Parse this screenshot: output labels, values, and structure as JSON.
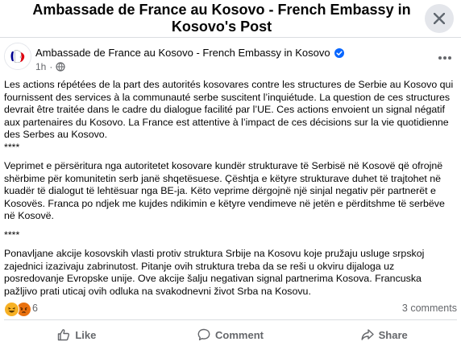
{
  "dialog": {
    "title": "Ambassade de France au Kosovo - French Embassy in Kosovo's Post",
    "close_icon": "close-icon"
  },
  "post": {
    "author": "Ambassade de France au Kosovo - French Embassy in Kosovo",
    "verified_icon": "verified-badge-icon",
    "time": "1h",
    "audience_icon": "globe-icon",
    "more_icon": "more-horizontal-icon",
    "paragraphs": [
      "Les actions répétées de la part des autorités kosovares contre les structures de Serbie au Kosovo qui fournissent des services à la communauté serbe suscitent l’inquiétude. La question de ces structures devrait être traitée dans le cadre du dialogue facilité par l’UE. Ces actions envoient un signal négatif aux partenaires du Kosovo. La France est attentive à l’impact de ces décisions sur la vie quotidienne des Serbes au  Kosovo.",
      "****",
      "Veprimet e përsëritura nga autoritetet kosovare kundër strukturave të Serbisë në Kosovë që ofrojnë shërbime për komunitetin serb janë shqetësuese. Çështja e këtyre strukturave duhet të trajtohet në kuadër të dialogut të lehtësuar nga BE-ja. Këto veprime dërgojnë një sinjal negativ për partnerët e Kosovës. Franca po ndjek me kujdes ndikimin e këtyre vendimeve në jetën e përditshme të serbëve në Kosovë.",
      "****",
      "Ponavljane akcije kosovskih vlasti protiv struktura Srbije na Kosovu koje pružaju usluge srpskoj zajednici izazivaju zabrinutost. Pitanje ovih struktura treba da se reši u okviru dijaloga uz posredovanje Evropske unije. Ove akcije šalju negativan signal partnerima Kosova. Francuska pažljivo prati uticaj ovih odluka na svakodnevni život Srba na Kosovu."
    ]
  },
  "reactions": {
    "icons": [
      "haha-reaction-icon",
      "angry-reaction-icon"
    ],
    "count": "6",
    "comments": "3 comments"
  },
  "actions": {
    "like": "Like",
    "comment": "Comment",
    "share": "Share"
  },
  "colors": {
    "verified": "#0866ff",
    "secondary_text": "#65676b",
    "haha": "#f7b125",
    "angry": "#e9710f"
  }
}
